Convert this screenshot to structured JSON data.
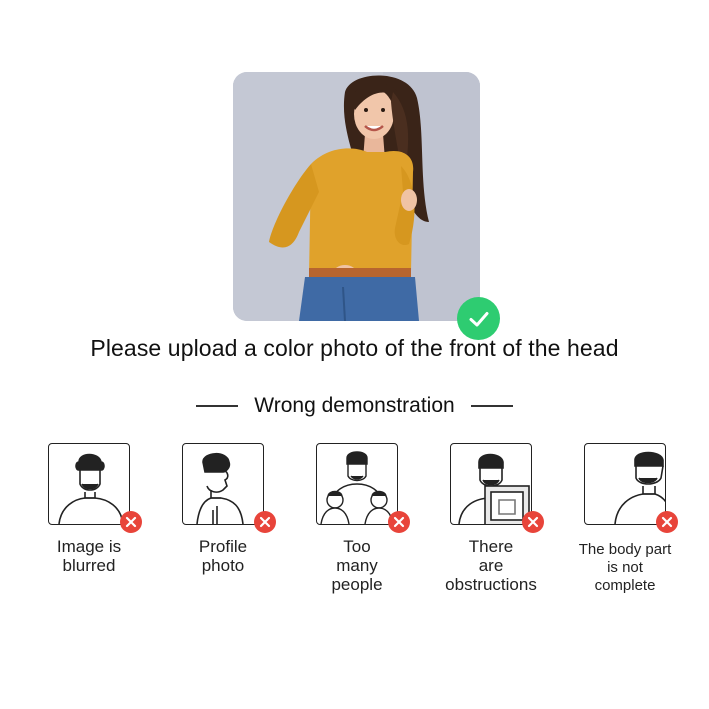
{
  "hero": {
    "image": "woman-in-yellow-sweater-photo",
    "status_icon": "check-icon",
    "status_color": "#2ecc71"
  },
  "instruction": {
    "text": "Please upload a color photo of the front of the head"
  },
  "section": {
    "title": "Wrong demonstration"
  },
  "examples": [
    {
      "label_lines": [
        "Image is",
        "blurred"
      ],
      "icon": "blurred-portrait-icon",
      "status_icon": "error-x-icon"
    },
    {
      "label_lines": [
        "Profile",
        "photo"
      ],
      "icon": "profile-portrait-icon",
      "status_icon": "error-x-icon"
    },
    {
      "label_lines": [
        "Too",
        "many",
        "people"
      ],
      "icon": "group-portrait-icon",
      "status_icon": "error-x-icon"
    },
    {
      "label_lines": [
        "There",
        "are",
        "obstructions"
      ],
      "icon": "obstructed-portrait-icon",
      "status_icon": "error-x-icon"
    },
    {
      "label_lines": [
        "The body part",
        "is not",
        "complete"
      ],
      "icon": "cropped-portrait-icon",
      "status_icon": "error-x-icon"
    }
  ],
  "colors": {
    "error": "#e8443a",
    "success": "#2ecc71"
  }
}
